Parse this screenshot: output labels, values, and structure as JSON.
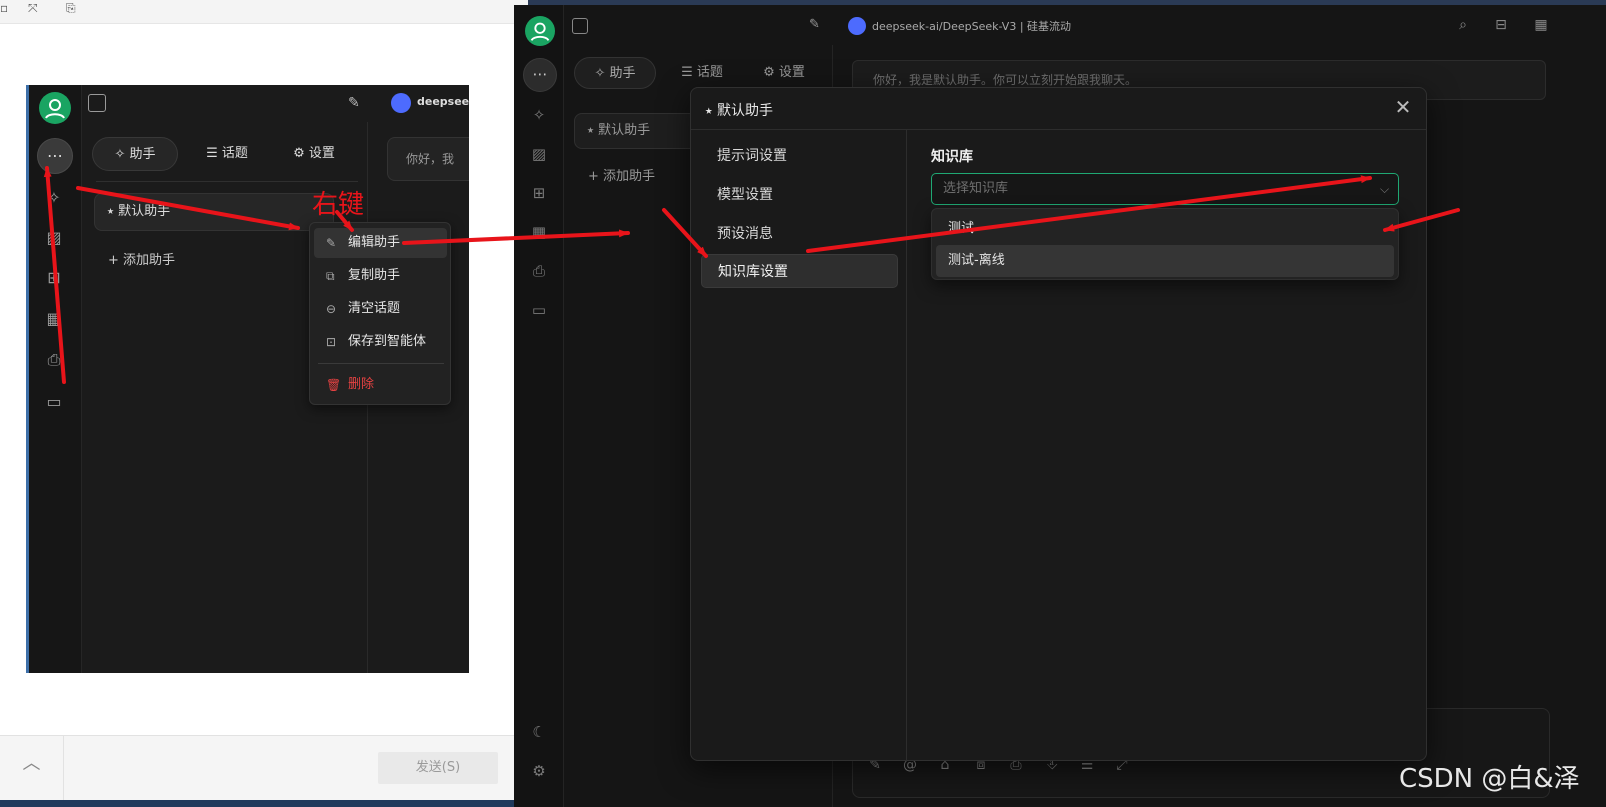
{
  "background_window": {
    "send_label": "发送(S)"
  },
  "inset": {
    "model_name": "deepseek-",
    "tabs": [
      {
        "icon": "✧",
        "label": "助手"
      },
      {
        "icon": "☰",
        "label": "话题"
      },
      {
        "icon": "⚙",
        "label": "设置"
      }
    ],
    "assistant_item": "⭑ 默认助手",
    "add_assistant": "+ 添加助手",
    "greeting": "你好，我",
    "right_click_note": "右键",
    "context_menu": [
      {
        "icon": "✎",
        "label": "编辑助手"
      },
      {
        "icon": "⧉",
        "label": "复制助手"
      },
      {
        "icon": "⊖",
        "label": "清空话题"
      },
      {
        "icon": "⊡",
        "label": "保存到智能体"
      },
      {
        "icon": "🗑",
        "label": "删除"
      }
    ]
  },
  "app": {
    "title": "deepseek-ai/DeepSeek-V3 | 硅基流动",
    "tabs": [
      {
        "icon": "✧",
        "label": "助手"
      },
      {
        "icon": "☰",
        "label": "话题"
      },
      {
        "icon": "⚙",
        "label": "设置"
      }
    ],
    "assistant_item": "⭑ 默认助手",
    "add_assistant": "+ 添加助手",
    "greeting": "你好，我是默认助手。你可以立刻开始跟我聊天。"
  },
  "modal": {
    "title": "⭑ 默认助手",
    "nav": [
      "提示词设置",
      "模型设置",
      "预设消息",
      "知识库设置"
    ],
    "active_nav": "知识库设置",
    "section_title": "知识库",
    "select_placeholder": "选择知识库",
    "options": [
      "测试",
      "测试-离线"
    ],
    "highlighted_option": "测试-离线"
  },
  "watermark": "CSDN @白&泽",
  "colors": {
    "annotation_red": "#e8141a",
    "accent_green": "#1fa873",
    "avatar_green": "#1aa462",
    "danger_red": "#e54242"
  }
}
